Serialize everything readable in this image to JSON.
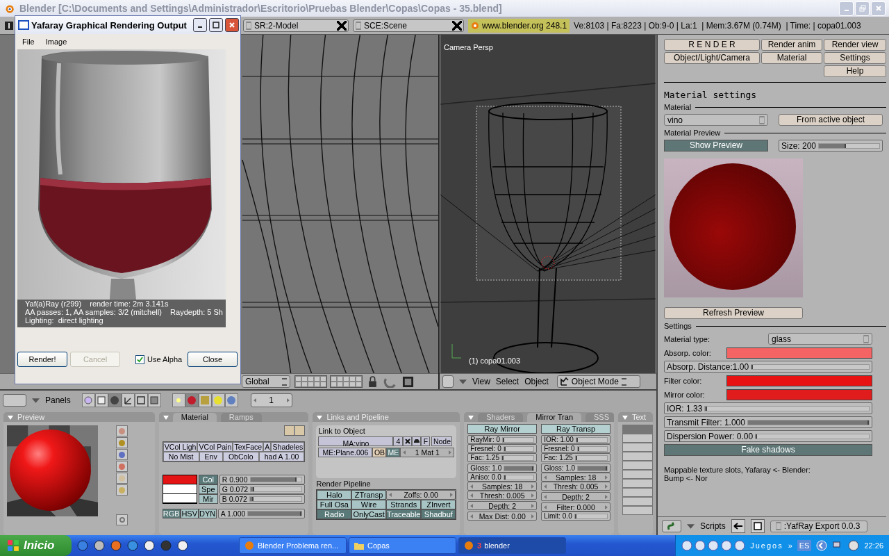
{
  "window": {
    "title": "Blender [C:\\Documents and Settings\\Administrador\\Escritorio\\Pruebas Blender\\Copas\\Copas - 35.blend]"
  },
  "header": {
    "screen": "SR:2-Model",
    "scene": "SCE:Scene",
    "site": "www.blender.org 248.1",
    "stats": "Ve:8103 | Fa:8223 | Ob:9-0 | La:1  | Mem:3.67M (0.74M)  | Time: | copa01.003"
  },
  "render_window": {
    "title": "Yafaray Graphical Rendering Output",
    "menu": [
      "File",
      "Image"
    ],
    "info": [
      "Yaf(a)Ray (r299)    render time: 2m 3.141s",
      "AA passes: 1, AA samples: 3/2 (mitchell)    Raydepth: 5 Sh",
      "Lighting:  direct lighting"
    ],
    "controls": [
      {
        "kind": "button",
        "label": "Render!",
        "disabled": false
      },
      {
        "kind": "button",
        "label": "Cancel",
        "disabled": true
      },
      {
        "kind": "checkbox",
        "label": "Use Alpha",
        "checked": true
      },
      {
        "kind": "button",
        "label": "Close",
        "disabled": false
      }
    ]
  },
  "viewport": {
    "transform": "Global"
  },
  "camera_view": {
    "label": "Camera Persp",
    "object": "(1) copa01.003",
    "menus": [
      "View",
      "Select",
      "Object"
    ],
    "mode": "Object Mode"
  },
  "buttons_window": {
    "menu": "Panels",
    "frame": "1",
    "contexts": [
      {
        "selected": false
      },
      {
        "selected": false
      },
      {
        "selected": true
      },
      {
        "selected": false
      },
      {
        "selected": false
      },
      {
        "selected": false
      }
    ],
    "subcontexts": [
      {
        "selected": false
      },
      {
        "selected": true
      },
      {
        "selected": false
      },
      {
        "selected": false
      },
      {
        "selected": false
      }
    ],
    "preview": {
      "title": "Preview"
    },
    "material": {
      "tabs": [
        {
          "label": "Material",
          "selected": true
        },
        {
          "label": "Ramps",
          "selected": false
        }
      ],
      "toggles": [
        [
          "VCol Ligh",
          "VCol Pain",
          "TexFace",
          "A",
          "Shadeles"
        ],
        [
          "No Mist",
          "Env",
          "ObColo",
          "had A 1.00"
        ]
      ],
      "colors": [
        {
          "label": "Col",
          "selected": true,
          "color": "#e41414"
        },
        {
          "label": "Spe",
          "selected": false,
          "color": "#ffffff"
        },
        {
          "label": "Mir",
          "selected": false,
          "color": "#ffffff"
        }
      ],
      "sliders": [
        {
          "label": "R 0.900",
          "level": 0.9
        },
        {
          "label": "G 0.072",
          "level": 0.072
        },
        {
          "label": "B 0.072",
          "level": 0.072
        }
      ],
      "modes": [
        {
          "label": "RGB",
          "selected": true
        },
        {
          "label": "HSV",
          "selected": false
        },
        {
          "label": "DYN",
          "selected": false
        }
      ],
      "alpha": {
        "label": "A 1.000",
        "level": 1.0
      }
    },
    "links": {
      "title": "Links and Pipeline",
      "link_label": "Link to Object",
      "material": "MA:vino",
      "users": "4",
      "fake": "F",
      "node": "Node",
      "mesh": "ME:Plane.006",
      "owners": [
        {
          "label": "OB",
          "selected": false
        },
        {
          "label": "ME",
          "selected": true
        }
      ],
      "mat_index": "1 Mat 1",
      "pipeline_label": "Render Pipeline",
      "pipeline": [
        {
          "label": "Halo",
          "on": false
        },
        {
          "label": "ZTransp",
          "on": false
        },
        {
          "label": "Full Osa",
          "on": false
        },
        {
          "label": "Wire",
          "on": false
        },
        {
          "label": "Strands",
          "on": false
        },
        {
          "label": "ZInvert",
          "on": false
        },
        {
          "label": "Radio",
          "on": true
        },
        {
          "label": "OnlyCast",
          "on": false
        },
        {
          "label": "Traceable",
          "on": true
        },
        {
          "label": "Shadbuf",
          "on": true
        }
      ],
      "zoffs": "Zoffs: 0.00"
    },
    "shaders": {
      "tabs": [
        {
          "label": "Shaders",
          "selected": false
        },
        {
          "label": "Mirror Tran",
          "selected": true
        },
        {
          "label": "SSS",
          "selected": false
        }
      ],
      "columns": [
        {
          "header": "Ray Mirror",
          "groups": [
            [
              {
                "kind": "slider",
                "label": "RayMir: 0",
                "level": 0
              },
              {
                "kind": "slider",
                "label": "Fresnel: 0",
                "level": 0
              },
              {
                "kind": "slider",
                "label": "Fac: 1.25",
                "level": 0.05
              }
            ],
            [
              {
                "kind": "slider",
                "label": "Gloss: 1.0",
                "level": 1
              },
              {
                "kind": "slider",
                "label": "Aniso: 0.0",
                "level": 0
              },
              {
                "kind": "number",
                "label": "Samples: 18"
              },
              {
                "kind": "number",
                "label": "Thresh: 0.005"
              }
            ],
            [
              {
                "kind": "number",
                "label": "Depth: 2"
              }
            ],
            [
              {
                "kind": "number",
                "label": "Max Dist: 0.00"
              }
            ]
          ]
        },
        {
          "header": "Ray Transp",
          "groups": [
            [
              {
                "kind": "slider",
                "label": "IOR: 1.00",
                "level": 0
              },
              {
                "kind": "slider",
                "label": "Fresnel: 0",
                "level": 0
              },
              {
                "kind": "slider",
                "label": "Fac: 1.25",
                "level": 0.05
              }
            ],
            [
              {
                "kind": "slider",
                "label": "Gloss: 1.0",
                "level": 1
              },
              {
                "kind": "number",
                "label": "Samples: 18"
              },
              {
                "kind": "number",
                "label": "Thresh: 0.005"
              }
            ],
            [
              {
                "kind": "number",
                "label": "Depth: 2"
              }
            ],
            [
              {
                "kind": "number",
                "label": "Filter: 0.000"
              },
              {
                "kind": "slider",
                "label": "Limit: 0.0",
                "level": 0
              }
            ]
          ]
        }
      ]
    },
    "texture": {
      "title": "Text",
      "slots": [
        {
          "selected": true
        },
        {
          "selected": false
        },
        {
          "selected": false
        },
        {
          "selected": false
        },
        {
          "selected": false
        },
        {
          "selected": false
        },
        {
          "selected": false
        },
        {
          "selected": false
        },
        {
          "selected": false
        },
        {
          "selected": false
        }
      ]
    }
  },
  "yafaray": {
    "buttons": [
      "R E N D E R",
      "Render anim",
      "Render view",
      "Object/Light/Camera",
      "Material",
      "Settings",
      "Help"
    ],
    "heading": "Material settings",
    "material_label": "Material",
    "material": "vino",
    "from_active": "From active object",
    "preview_label": "Material Preview",
    "show_preview": {
      "label": "Show Preview",
      "on": true
    },
    "size": {
      "label": "Size: 200",
      "level": 0.45
    },
    "refresh": "Refresh Preview",
    "settings_label": "Settings",
    "rows": [
      {
        "kind": "select",
        "label": "Material type:",
        "value": "glass"
      },
      {
        "kind": "color",
        "label": "Absorp. color:",
        "color": "#f46464"
      },
      {
        "kind": "slider",
        "label": "Absorp. Distance:1.00",
        "level": 0.01
      },
      {
        "kind": "color",
        "label": "Filter color:",
        "color": "#e81212"
      },
      {
        "kind": "color",
        "label": "Mirror color:",
        "color": "#e01c1c"
      },
      {
        "kind": "slider",
        "label": "IOR: 1.33",
        "level": 0.01
      },
      {
        "kind": "slider",
        "label": "Transmit Filter: 1.000",
        "level": 1
      },
      {
        "kind": "slider",
        "label": "Dispersion Power: 0.00",
        "level": 0
      },
      {
        "kind": "toggle",
        "label": "Fake shadows",
        "on": true
      }
    ],
    "note": [
      "Mappable texture slots, Yafaray <- Blender:",
      "Bump <- Nor"
    ],
    "scripts": "Scripts",
    "script": ":YafRay Export 0.0.3"
  },
  "taskbar": {
    "start": "Inicio",
    "tasks": [
      {
        "label": "Blender Problema ren...",
        "selected": false
      },
      {
        "label": "Copas",
        "selected": false
      },
      {
        "label": "blender",
        "count": "3",
        "selected": true
      }
    ],
    "toolbar": "Juegos",
    "more": "»",
    "language": "ES",
    "clock": "22:26"
  }
}
